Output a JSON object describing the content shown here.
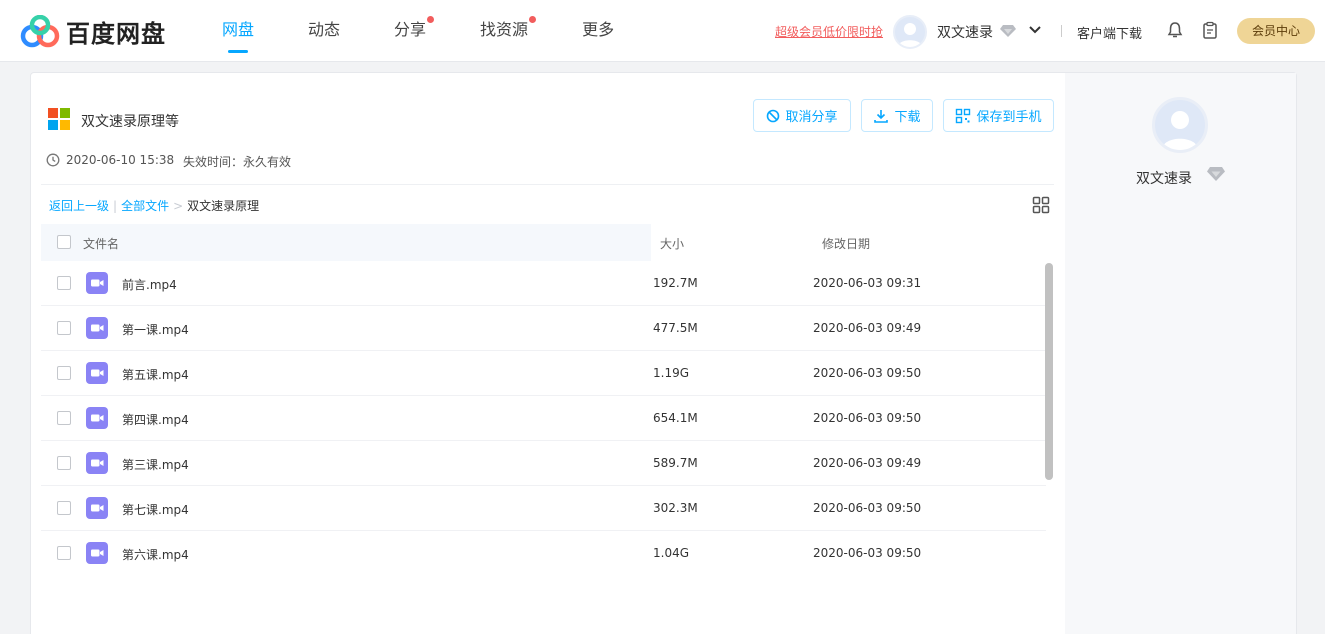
{
  "header": {
    "logo_text": "百度网盘",
    "nav": [
      {
        "label": "网盘",
        "active": true,
        "dot": false
      },
      {
        "label": "动态",
        "active": false,
        "dot": false
      },
      {
        "label": "分享",
        "active": false,
        "dot": true
      },
      {
        "label": "找资源",
        "active": false,
        "dot": true
      },
      {
        "label": "更多",
        "active": false,
        "dot": false
      }
    ],
    "promo": "超级会员低价限时抢",
    "username": "双文速录",
    "client_download": "客户端下载",
    "member_center": "会员中心"
  },
  "share": {
    "title": "双文速录原理等",
    "buttons": {
      "cancel": "取消分享",
      "download": "下载",
      "save_phone": "保存到手机"
    },
    "created": "2020-06-10 15:38",
    "expire": "失效时间：永久有效"
  },
  "breadcrumb": {
    "back": "返回上一级",
    "sep": "|",
    "all": "全部文件",
    "arrow": ">",
    "current": "双文速录原理"
  },
  "table": {
    "headers": {
      "name": "文件名",
      "size": "大小",
      "date": "修改日期"
    },
    "rows": [
      {
        "name": "前言.mp4",
        "size": "192.7M",
        "date": "2020-06-03 09:31"
      },
      {
        "name": "第一课.mp4",
        "size": "477.5M",
        "date": "2020-06-03 09:49"
      },
      {
        "name": "第五课.mp4",
        "size": "1.19G",
        "date": "2020-06-03 09:50"
      },
      {
        "name": "第四课.mp4",
        "size": "654.1M",
        "date": "2020-06-03 09:50"
      },
      {
        "name": "第三课.mp4",
        "size": "589.7M",
        "date": "2020-06-03 09:49"
      },
      {
        "name": "第七课.mp4",
        "size": "302.3M",
        "date": "2020-06-03 09:50"
      },
      {
        "name": "第六课.mp4",
        "size": "1.04G",
        "date": "2020-06-03 09:50"
      }
    ]
  },
  "sidebar": {
    "username": "双文速录"
  },
  "colors": {
    "accent": "#06a7ff",
    "promo": "#f25d5d",
    "member_gold": "#efd596",
    "video_icon": "#8a83f5"
  },
  "icons": {
    "logo": "baidu-netdisk-logo",
    "share": "four-color-square-icon",
    "vip": "diamond-icon",
    "bell": "bell-icon",
    "clipboard": "clipboard-icon",
    "grid": "grid-view-icon",
    "clock": "clock-icon",
    "video": "video-file-icon"
  }
}
